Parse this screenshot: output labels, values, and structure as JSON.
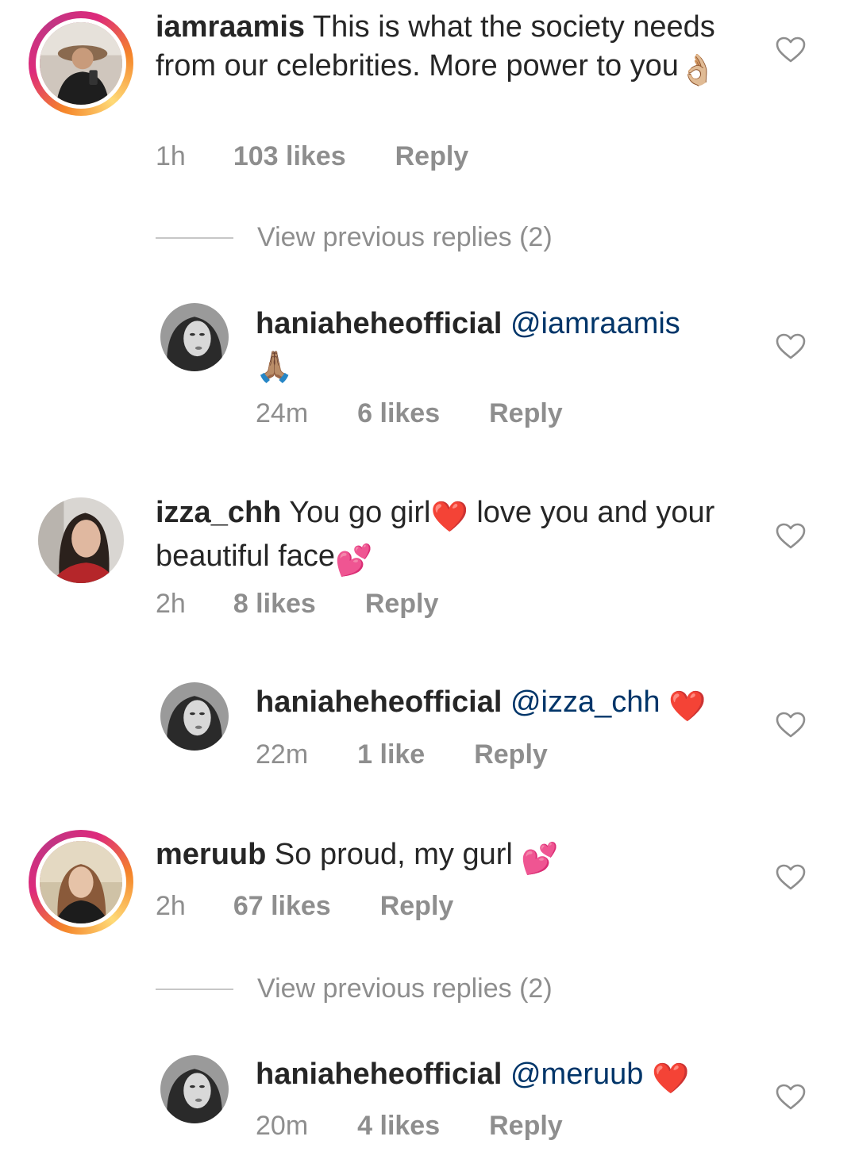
{
  "comments": [
    {
      "username": "iamraamis",
      "text": "This is what the society needs from our celebrities. More power to you",
      "emoji": "👌🏼",
      "time": "1h",
      "likes": "103 likes",
      "reply": "Reply",
      "view_replies": "View previous replies (2)",
      "replies": [
        {
          "username": "haniaheheofficial",
          "mention": "@iamraamis",
          "emoji": "🙏🏽",
          "time": "24m",
          "likes": "6 likes",
          "reply": "Reply"
        }
      ]
    },
    {
      "username": "izza_chh",
      "text_a": "You go girl",
      "emoji_a": "❤️",
      "text_b": "love you and your beautiful face",
      "emoji_b": "💕",
      "time": "2h",
      "likes": "8 likes",
      "reply": "Reply",
      "replies": [
        {
          "username": "haniaheheofficial",
          "mention": "@izza_chh",
          "emoji": "❤️",
          "time": "22m",
          "likes": "1 like",
          "reply": "Reply"
        }
      ]
    },
    {
      "username": "meruub",
      "text": "So proud, my gurl",
      "emoji": "💕",
      "time": "2h",
      "likes": "67 likes",
      "reply": "Reply",
      "view_replies": "View previous replies (2)",
      "replies": [
        {
          "username": "haniaheheofficial",
          "mention": "@meruub",
          "emoji": "❤️",
          "time": "20m",
          "likes": "4 likes",
          "reply": "Reply"
        }
      ]
    }
  ],
  "colors": {
    "text": "#262626",
    "muted": "#8e8e8e",
    "mention": "#003569",
    "heart_red": "#e0202c",
    "story_ring_start": "#f58529",
    "story_ring_end": "#dd2a7b"
  },
  "icons": {
    "like": "heart-outline-icon"
  }
}
